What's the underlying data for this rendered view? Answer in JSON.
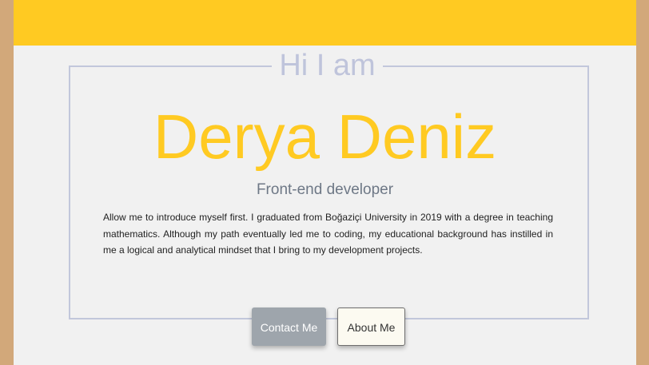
{
  "hero": {
    "greeting": "Hi I am",
    "name": "Derya Deniz",
    "role": "Front-end developer",
    "intro": "Allow me to introduce myself first. I graduated from Boğaziçi University in 2019 with a degree in teaching mathematics. Although my path eventually led me to coding, my educational background has instilled in me a logical and analytical mindset that I bring to my development projects."
  },
  "buttons": {
    "contact_label": "Contact Me",
    "about_label": "About Me"
  },
  "colors": {
    "accent_yellow": "#FFCA22",
    "frame_border": "#C2C7DB",
    "page_background": "#F1F1F1",
    "outer_background": "#D2A87A",
    "contact_button": "#9EA5AC",
    "about_button": "#FCFAF1"
  }
}
